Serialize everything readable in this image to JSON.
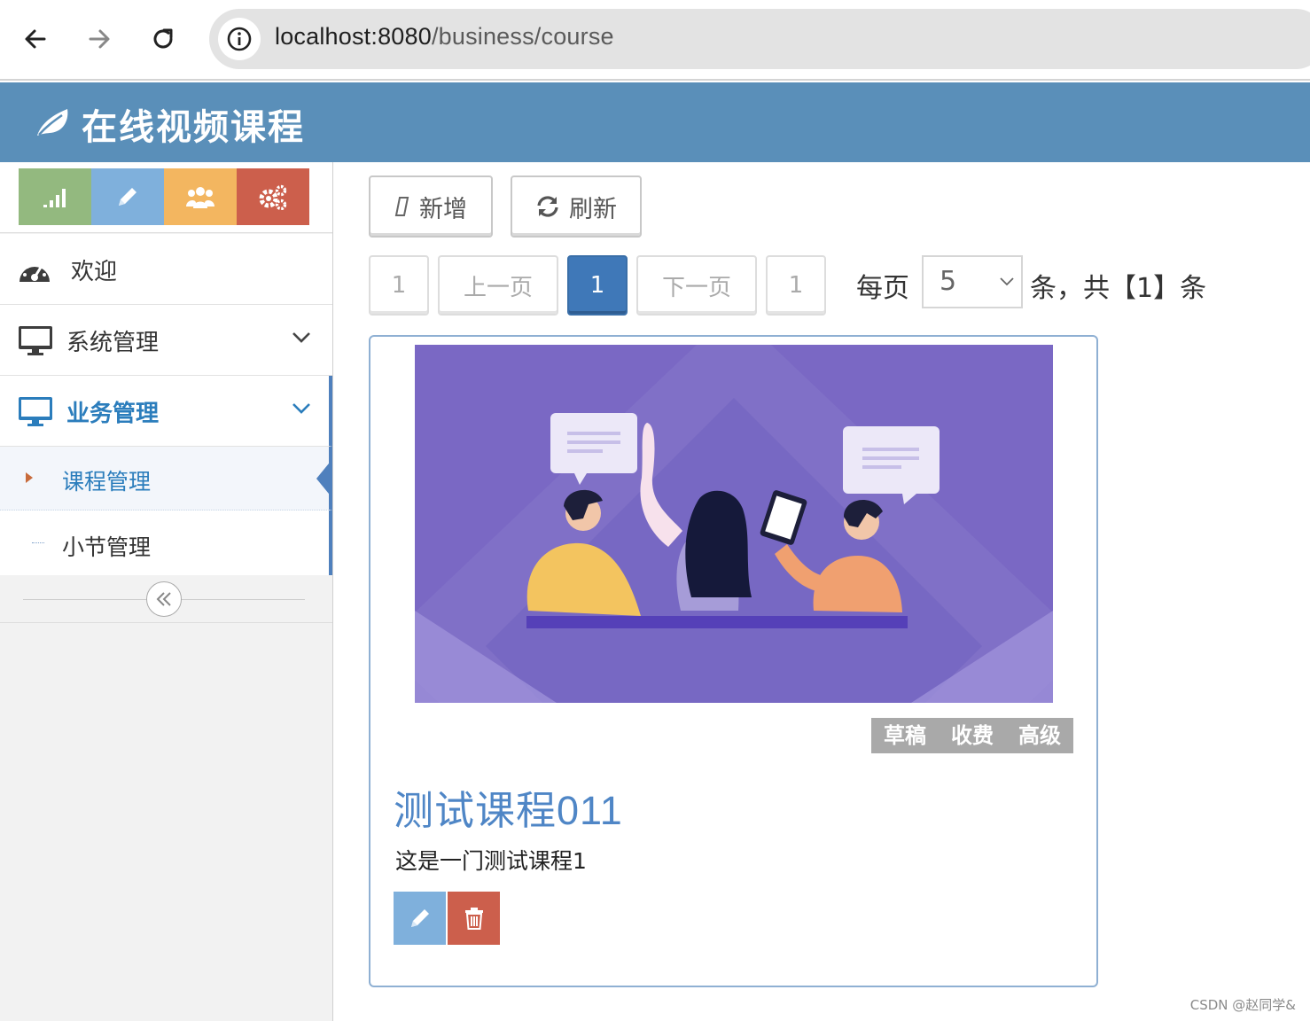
{
  "browser": {
    "url_host": "localhost:8080",
    "url_path": "/business/course"
  },
  "header": {
    "title": "在线视频课程",
    "color": "#5a8fb9"
  },
  "sidebar": {
    "shortcuts": [
      {
        "icon": "signal-icon",
        "color": "#93b97f"
      },
      {
        "icon": "pencil-icon",
        "color": "#7fb0dc"
      },
      {
        "icon": "users-icon",
        "color": "#f3b660"
      },
      {
        "icon": "cogs-icon",
        "color": "#cc5f4c"
      }
    ],
    "items": [
      {
        "label": "欢迎",
        "icon": "tachometer-icon"
      },
      {
        "label": "系统管理",
        "icon": "desktop-icon"
      },
      {
        "label": "业务管理",
        "icon": "desktop-icon"
      }
    ],
    "submenu": [
      {
        "label": "课程管理"
      },
      {
        "label": "小节管理"
      }
    ]
  },
  "toolbar": {
    "add_label": "新增",
    "refresh_label": "刷新"
  },
  "pager": {
    "first": "1",
    "prev": "上一页",
    "current": "1",
    "next": "下一页",
    "last": "1",
    "per_page_label": "每页",
    "page_size": "5",
    "total_text": "条，共【1】条"
  },
  "course": {
    "badges": [
      "草稿",
      "收费",
      "高级"
    ],
    "name": "测试课程011",
    "summary": "这是一门测试课程1"
  },
  "watermark": "CSDN @赵同学&"
}
